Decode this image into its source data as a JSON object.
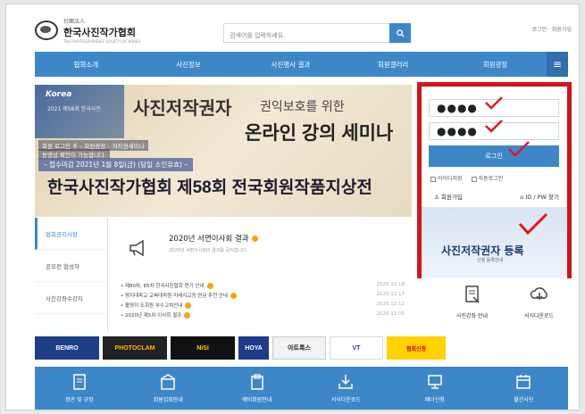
{
  "header": {
    "logo_small": "社團法人",
    "logo_name": "한국사진작가협회",
    "logo_sub": "THE PHOTOGRAPHERS' SOCIETY OF KOREA",
    "search_placeholder": "검색어를 입력하세요.",
    "top_links": "로그인 · 회원가입"
  },
  "nav": {
    "items": [
      "협회소개",
      "사진정보",
      "사진행사 결과",
      "회원갤러리",
      "회원광장"
    ],
    "menu_icon": "hamburger-icon"
  },
  "banner": {
    "badge": "Korea",
    "badge_sub": "2021 제58회 한국사진",
    "title1": "사진저작권자",
    "title1b": "권익보호를 위한",
    "title2": "온라인 강의 세미나",
    "note1": "회원 로그인 후 – 회원광장 – 저작권세미나",
    "note2": "동영상 확인이 가능합니다.",
    "deadline": "– 접수마감 2021년 1월 8일(금) (당일 소인유효) –",
    "big": "한국사진작가협회 제58회 전국회원작품지상전"
  },
  "login": {
    "id_value": "●●●●",
    "pw_value": "●●●●",
    "login_button": "로그인",
    "save_id": "아이디저장",
    "auto_login": "자동로그인",
    "join": "회원가입",
    "find": "ID / PW 찾기",
    "register_title": "사진저작권자 등록",
    "register_sub": "신청 등록안내"
  },
  "side_menu": [
    "협회공지사항",
    "공모전 협성자",
    "사진강좌수강자"
  ],
  "notice": {
    "title": "2020년 서면이사회 결과",
    "desc": "2020년 서면이사회의 결과를 공지합니다."
  },
  "news": [
    {
      "text": "• 제80차, 85차 한국사진협회 연기 안내",
      "date": "2020.12.18"
    },
    {
      "text": "• 명지대학교 교육대학원 미래지교정 연금 추천 안내",
      "date": "2020.12.17"
    },
    {
      "text": "• 촬영지 도회원 부수고쳐안내",
      "date": "2020.12.12"
    },
    {
      "text": "• 2020년 제5차 이사회 결과",
      "date": "2020.12.05"
    }
  ],
  "quick": [
    {
      "label": "사진강좌 안내",
      "icon": "document-edit-icon"
    },
    {
      "label": "서식다운로드",
      "icon": "cloud-download-icon"
    }
  ],
  "sponsors": [
    "BENRO",
    "PHOTOCLAM",
    "NiSi",
    "HOYA",
    "아트록스",
    "VT",
    "협회신청"
  ],
  "footer": [
    {
      "label": "정관 및 규정",
      "icon": "document-list-icon"
    },
    {
      "label": "회원입회안내",
      "icon": "building-icon"
    },
    {
      "label": "예비회원안내",
      "icon": "clipboard-icon"
    },
    {
      "label": "서식다운로드",
      "icon": "download-icon"
    },
    {
      "label": "배너신청",
      "icon": "monitor-icon"
    },
    {
      "label": "월간사진",
      "icon": "calendar-icon"
    }
  ],
  "colors": {
    "primary": "#3d87c9",
    "highlight": "#d0161b",
    "check": "#e01820"
  }
}
